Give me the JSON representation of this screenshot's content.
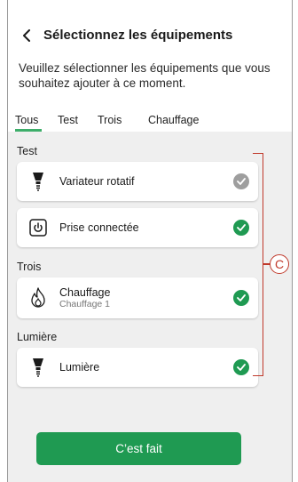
{
  "header": {
    "title": "Sélectionnez les équipements",
    "subtitle": "Veuillez sélectionner les équipements que vous souhaitez ajouter à ce moment.",
    "back_icon": "chevron-left-icon"
  },
  "tabs": [
    {
      "label": "Tous",
      "active": true
    },
    {
      "label": "Test",
      "active": false
    },
    {
      "label": "Trois",
      "active": false
    },
    {
      "label": "Chauffage",
      "active": false
    }
  ],
  "sections": [
    {
      "label": "Test",
      "devices": [
        {
          "name": "Variateur rotatif",
          "icon": "bulb-icon",
          "selected": false
        },
        {
          "name": "Prise connectée",
          "icon": "power-plug-icon",
          "selected": true
        }
      ]
    },
    {
      "label": "Trois",
      "devices": [
        {
          "name": "Chauffage",
          "subtitle": "Chauffage 1",
          "icon": "flame-icon",
          "selected": true
        }
      ]
    },
    {
      "label": "Lumière",
      "devices": [
        {
          "name": "Lumière",
          "icon": "bulb-icon",
          "selected": true
        }
      ]
    }
  ],
  "callout": {
    "label": "C"
  },
  "footer": {
    "done_label": "C’est fait"
  },
  "colors": {
    "accent": "#3dae6a",
    "check_selected": "#1f9a52",
    "check_unselected": "#9e9e9e",
    "button": "#1f9a52",
    "callout": "#c0392b",
    "list_background": "#efefef"
  }
}
